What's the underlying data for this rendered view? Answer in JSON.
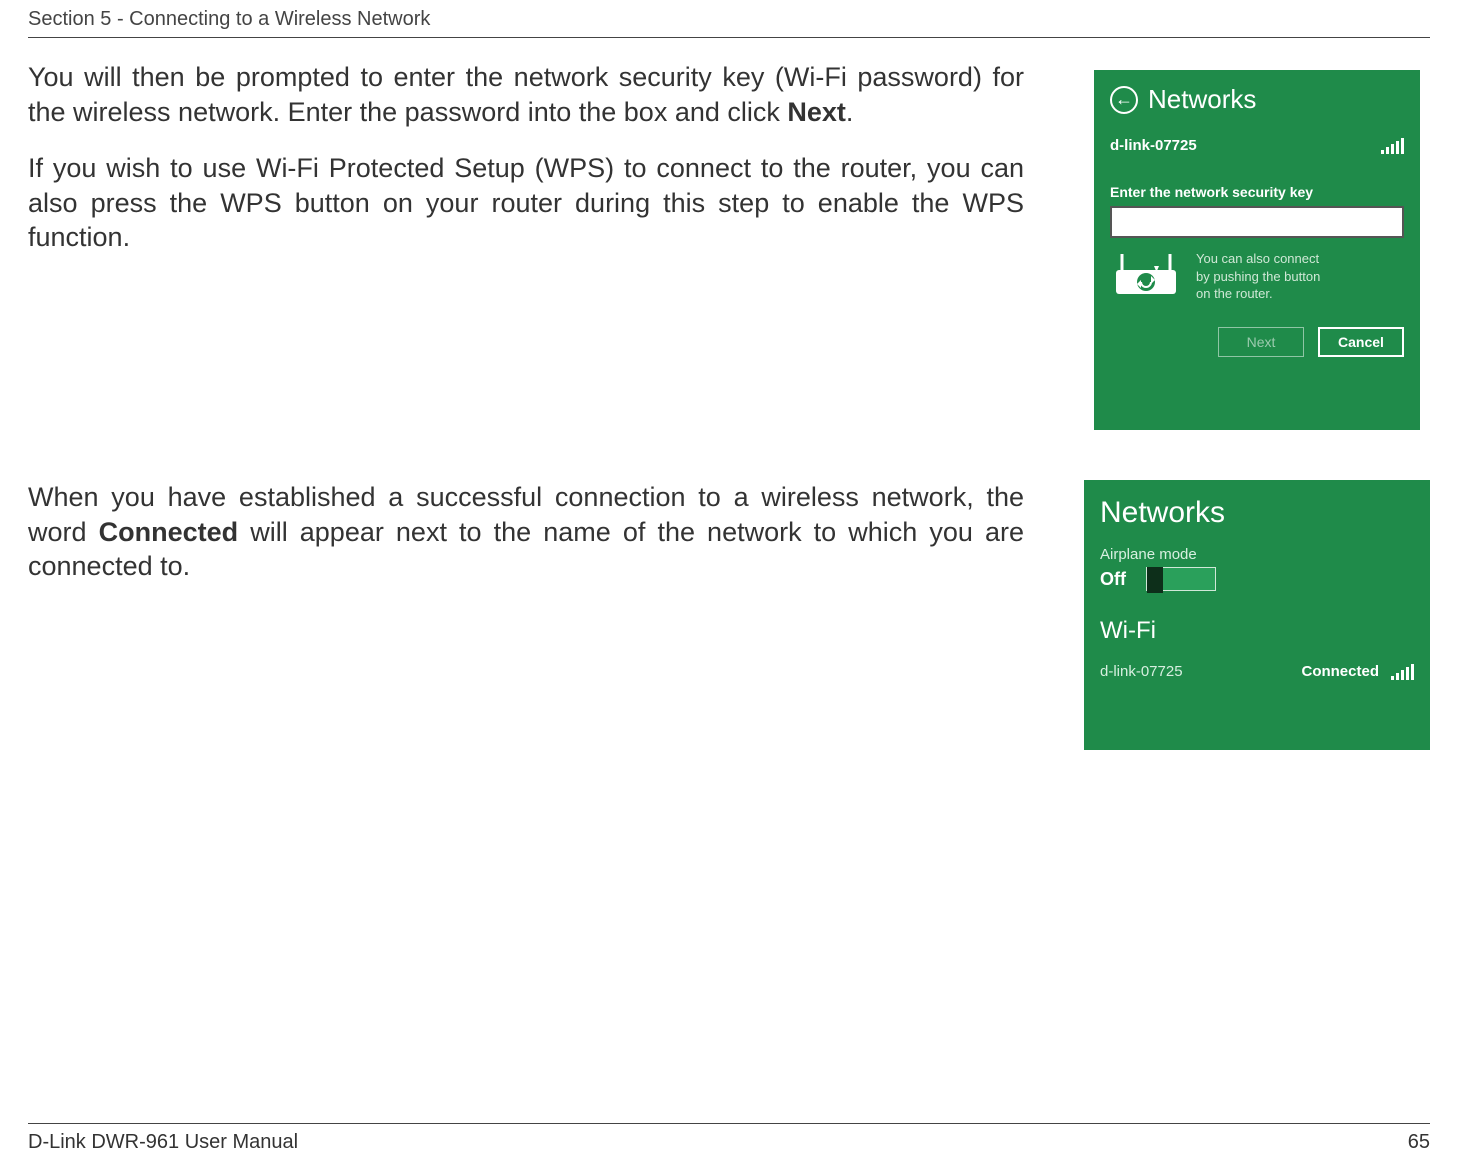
{
  "header": {
    "section_title": "Section 5 - Connecting to a Wireless Network"
  },
  "para1": {
    "t1": "You will then be prompted to enter the network security key (Wi-Fi password) for the wireless network. Enter the password into the box and click ",
    "bold": "Next",
    "t2": "."
  },
  "para2": "If you wish to use Wi-Fi Protected Setup (WPS) to connect to the router, you can also press the WPS button on your router during this step to enable the WPS function.",
  "para3": {
    "t1": "When you have established a successful connection to a wireless network, the word ",
    "bold": "Connected",
    "t2": " will appear next to the name of the network to which you are connected to."
  },
  "shot1": {
    "title": "Networks",
    "network": "d-link-07725",
    "label": "Enter the network security key",
    "input_value": "",
    "input_placeholder": "",
    "wps_l1": "You can also connect",
    "wps_l2": "by pushing the button",
    "wps_l3": "on the router.",
    "next": "Next",
    "cancel": "Cancel"
  },
  "shot2": {
    "title": "Networks",
    "airplane_label": "Airplane mode",
    "airplane_value": "Off",
    "wifi_label": "Wi-Fi",
    "network": "d-link-07725",
    "status": "Connected"
  },
  "footer": {
    "left": "D-Link DWR-961 User Manual",
    "right": "65"
  }
}
